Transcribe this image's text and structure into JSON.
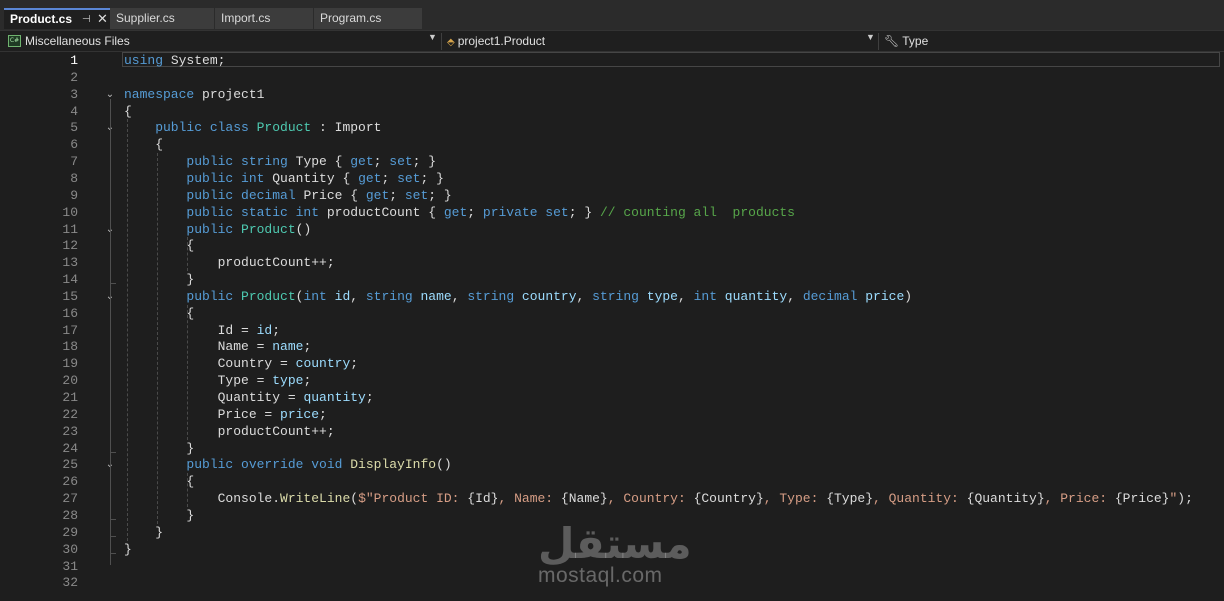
{
  "tabs": [
    {
      "label": "Product.cs",
      "active": true
    },
    {
      "label": "Supplier.cs",
      "active": false
    },
    {
      "label": "Import.cs",
      "active": false
    },
    {
      "label": "Program.cs",
      "active": false
    }
  ],
  "tab_icons": {
    "pin": "pin-icon",
    "close": "close-icon"
  },
  "navbar": {
    "project_scope": "Miscellaneous Files",
    "type_scope": "project1.Product",
    "member_scope": "Type"
  },
  "editor": {
    "current_line": 1,
    "line_numbers": [
      "1",
      "2",
      "3",
      "4",
      "5",
      "6",
      "7",
      "8",
      "9",
      "10",
      "11",
      "12",
      "13",
      "14",
      "15",
      "16",
      "17",
      "18",
      "19",
      "20",
      "21",
      "22",
      "23",
      "24",
      "25",
      "26",
      "27",
      "28",
      "29",
      "30",
      "31",
      "32"
    ],
    "code_lines": [
      [
        {
          "t": "using",
          "c": "kw"
        },
        {
          "t": " System;",
          "c": "pl"
        }
      ],
      [],
      [
        {
          "t": "namespace",
          "c": "kw"
        },
        {
          "t": " project1",
          "c": "pl"
        }
      ],
      [
        {
          "t": "{",
          "c": "pl"
        }
      ],
      [
        {
          "t": "    public class ",
          "c": "kw"
        },
        {
          "t": "Product",
          "c": "ty"
        },
        {
          "t": " : Import",
          "c": "pl"
        }
      ],
      [
        {
          "t": "    {",
          "c": "pl"
        }
      ],
      [
        {
          "t": "        public string ",
          "c": "kw"
        },
        {
          "t": "Type { ",
          "c": "pl"
        },
        {
          "t": "get",
          "c": "kw"
        },
        {
          "t": "; ",
          "c": "pl"
        },
        {
          "t": "set",
          "c": "kw"
        },
        {
          "t": "; }",
          "c": "pl"
        }
      ],
      [
        {
          "t": "        public int ",
          "c": "kw"
        },
        {
          "t": "Quantity { ",
          "c": "pl"
        },
        {
          "t": "get",
          "c": "kw"
        },
        {
          "t": "; ",
          "c": "pl"
        },
        {
          "t": "set",
          "c": "kw"
        },
        {
          "t": "; }",
          "c": "pl"
        }
      ],
      [
        {
          "t": "        public decimal ",
          "c": "kw"
        },
        {
          "t": "Price { ",
          "c": "pl"
        },
        {
          "t": "get",
          "c": "kw"
        },
        {
          "t": "; ",
          "c": "pl"
        },
        {
          "t": "set",
          "c": "kw"
        },
        {
          "t": "; }",
          "c": "pl"
        }
      ],
      [
        {
          "t": "        public static int ",
          "c": "kw"
        },
        {
          "t": "productCount { ",
          "c": "pl"
        },
        {
          "t": "get",
          "c": "kw"
        },
        {
          "t": "; ",
          "c": "pl"
        },
        {
          "t": "private set",
          "c": "kw"
        },
        {
          "t": "; } ",
          "c": "pl"
        },
        {
          "t": "// counting all  products",
          "c": "cm"
        }
      ],
      [
        {
          "t": "        public ",
          "c": "kw"
        },
        {
          "t": "Product",
          "c": "ty"
        },
        {
          "t": "()",
          "c": "pl"
        }
      ],
      [
        {
          "t": "        {",
          "c": "pl"
        }
      ],
      [
        {
          "t": "            productCount++;",
          "c": "pl"
        }
      ],
      [
        {
          "t": "        }",
          "c": "pl"
        }
      ],
      [
        {
          "t": "        public ",
          "c": "kw"
        },
        {
          "t": "Product",
          "c": "ty"
        },
        {
          "t": "(",
          "c": "pl"
        },
        {
          "t": "int",
          "c": "kw"
        },
        {
          "t": " id",
          "c": "pr"
        },
        {
          "t": ", ",
          "c": "pl"
        },
        {
          "t": "string",
          "c": "kw"
        },
        {
          "t": " name",
          "c": "pr"
        },
        {
          "t": ", ",
          "c": "pl"
        },
        {
          "t": "string",
          "c": "kw"
        },
        {
          "t": " country",
          "c": "pr"
        },
        {
          "t": ", ",
          "c": "pl"
        },
        {
          "t": "string",
          "c": "kw"
        },
        {
          "t": " type",
          "c": "pr"
        },
        {
          "t": ", ",
          "c": "pl"
        },
        {
          "t": "int",
          "c": "kw"
        },
        {
          "t": " quantity",
          "c": "pr"
        },
        {
          "t": ", ",
          "c": "pl"
        },
        {
          "t": "decimal",
          "c": "kw"
        },
        {
          "t": " price",
          "c": "pr"
        },
        {
          "t": ")",
          "c": "pl"
        }
      ],
      [
        {
          "t": "        {",
          "c": "pl"
        }
      ],
      [
        {
          "t": "            Id = ",
          "c": "pl"
        },
        {
          "t": "id",
          "c": "pr"
        },
        {
          "t": ";",
          "c": "pl"
        }
      ],
      [
        {
          "t": "            Name = ",
          "c": "pl"
        },
        {
          "t": "name",
          "c": "pr"
        },
        {
          "t": ";",
          "c": "pl"
        }
      ],
      [
        {
          "t": "            Country = ",
          "c": "pl"
        },
        {
          "t": "country",
          "c": "pr"
        },
        {
          "t": ";",
          "c": "pl"
        }
      ],
      [
        {
          "t": "            Type = ",
          "c": "pl"
        },
        {
          "t": "type",
          "c": "pr"
        },
        {
          "t": ";",
          "c": "pl"
        }
      ],
      [
        {
          "t": "            Quantity = ",
          "c": "pl"
        },
        {
          "t": "quantity",
          "c": "pr"
        },
        {
          "t": ";",
          "c": "pl"
        }
      ],
      [
        {
          "t": "            Price = ",
          "c": "pl"
        },
        {
          "t": "price",
          "c": "pr"
        },
        {
          "t": ";",
          "c": "pl"
        }
      ],
      [
        {
          "t": "            productCount++;",
          "c": "pl"
        }
      ],
      [
        {
          "t": "        }",
          "c": "pl"
        }
      ],
      [
        {
          "t": "        public override void ",
          "c": "kw"
        },
        {
          "t": "DisplayInfo",
          "c": "fn"
        },
        {
          "t": "()",
          "c": "pl"
        }
      ],
      [
        {
          "t": "        {",
          "c": "pl"
        }
      ],
      [
        {
          "t": "            Console.",
          "c": "pl"
        },
        {
          "t": "WriteLine",
          "c": "fn"
        },
        {
          "t": "(",
          "c": "pl"
        },
        {
          "t": "$\"Product ID: ",
          "c": "st"
        },
        {
          "t": "{Id}",
          "c": "pl"
        },
        {
          "t": ", Name: ",
          "c": "st"
        },
        {
          "t": "{Name}",
          "c": "pl"
        },
        {
          "t": ", Country: ",
          "c": "st"
        },
        {
          "t": "{Country}",
          "c": "pl"
        },
        {
          "t": ", Type: ",
          "c": "st"
        },
        {
          "t": "{Type}",
          "c": "pl"
        },
        {
          "t": ", Quantity: ",
          "c": "st"
        },
        {
          "t": "{Quantity}",
          "c": "pl"
        },
        {
          "t": ", Price: ",
          "c": "st"
        },
        {
          "t": "{Price}",
          "c": "pl"
        },
        {
          "t": "\"",
          "c": "st"
        },
        {
          "t": ");",
          "c": "pl"
        }
      ],
      [
        {
          "t": "        }",
          "c": "pl"
        }
      ],
      [
        {
          "t": "    }",
          "c": "pl"
        }
      ],
      [
        {
          "t": "}",
          "c": "pl"
        }
      ],
      [],
      []
    ],
    "fold_icon": "chevron-down-icon"
  },
  "colors": {
    "keyword": "#569cd6",
    "type": "#4ec9b0",
    "method": "#dcdcaa",
    "parameter": "#9cdcfe",
    "comment": "#57a64a",
    "string": "#d69d85",
    "background": "#1e1e1e"
  },
  "watermark": {
    "logo_text": "مستقل",
    "site": "mostaql.com"
  }
}
